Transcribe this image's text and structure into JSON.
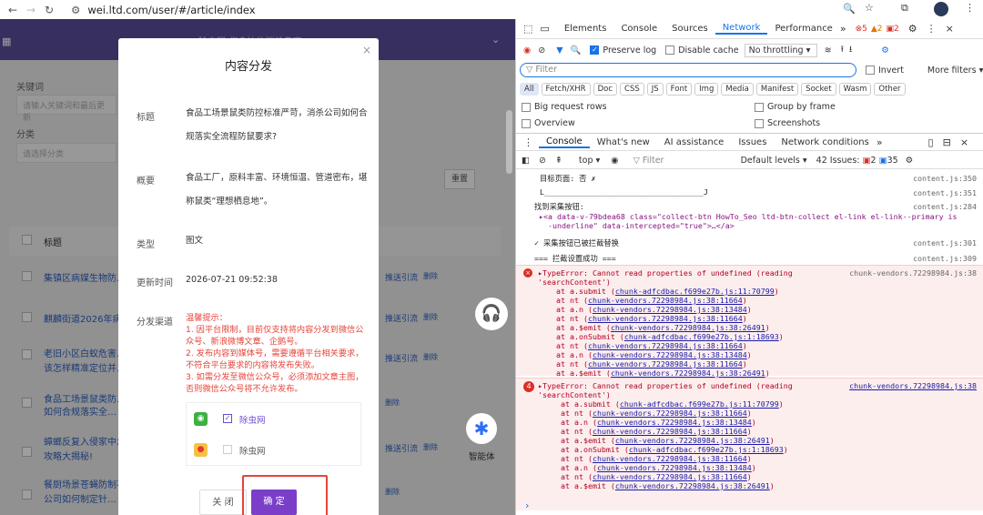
{
  "browser": {
    "url": "wei.ltd.com/user/#/article/index"
  },
  "bgpage": {
    "header": "除虫网-您身边的消杀专家",
    "keyword_label": "关键词",
    "keyword_placeholder": "请输入关键词和最后更新",
    "category_label": "分类",
    "category_placeholder": "请选择分类",
    "reset": "重置",
    "col_title": "标题",
    "rows": [
      {
        "title": "集镇区病媒生物防…",
        "a1": "推送引流",
        "a2": "删除"
      },
      {
        "title": "麒麟街道2026年病…",
        "a1": "推送引流",
        "a2": "删除"
      },
      {
        "title": "老旧小区白蚁危害…",
        "title2": "该怎样精准定位并…",
        "a1": "推送引流",
        "a2": "删除"
      },
      {
        "title": "食品工场景鼠类防…",
        "title2": "如何合规落实全…",
        "a1": "",
        "a2": "删除"
      },
      {
        "title": "蟑螂反复入侵家中怎…",
        "title2": "攻略大揭秘!",
        "a1": "推送引流",
        "a2": "删除"
      },
      {
        "title": "餐厨场景苍蝇防制不…",
        "title2": "公司如何制定针…",
        "a1": "",
        "a2": "删除"
      }
    ],
    "agent": "智能体"
  },
  "modal": {
    "title": "内容分发",
    "l_title": "标题",
    "v_title": "食品工场景鼠类防控标准严苛，消杀公司如何合规落实全流程防鼠要求?",
    "l_summary": "概要",
    "v_summary": "食品工厂，原料丰富、环境恒温、管道密布，堪称鼠类“理想栖息地”。",
    "l_type": "类型",
    "v_type": "图文",
    "l_time": "更新时间",
    "v_time": "2026-07-21 09:52:38",
    "l_channel": "分发渠道",
    "warn_title": "温馨提示：",
    "warn1": "1. 因平台限制，目前仅支持将内容分发到微信公众号、新浪微博文章、企鹅号。",
    "warn2": "2. 发布内容到媒体号，需要遵循平台相关要求，不符合平台要求的内容将发布失败。",
    "warn3": "3. 如需分发至微信公众号，必须添加文章主图，否则微信公众号将不允许发布。",
    "ch1": "除虫网",
    "ch2": "除虫网",
    "cancel": "关 闭",
    "ok": "确 定"
  },
  "devtools": {
    "tabs": [
      "Elements",
      "Console",
      "Sources",
      "Network",
      "Performance"
    ],
    "badge_err": "5",
    "badge_warn": "2",
    "badge_info": "2",
    "preserve": "Preserve log",
    "disable_cache": "Disable cache",
    "throttle": "No throttling",
    "filter": "Filter",
    "invert": "Invert",
    "more_filters": "More filters",
    "types": [
      "All",
      "Fetch/XHR",
      "Doc",
      "CSS",
      "JS",
      "Font",
      "Img",
      "Media",
      "Manifest",
      "Socket",
      "Wasm",
      "Other"
    ],
    "big": "Big request rows",
    "group": "Group by frame",
    "overview": "Overview",
    "screens": "Screenshots",
    "drawer_tabs": [
      "Console",
      "What's new",
      "AI assistance",
      "Issues",
      "Network conditions"
    ],
    "ctx": "top",
    "cfilter": "Filter",
    "levels": "Default levels",
    "issues": "42 Issues:",
    "iss_err": "2",
    "iss_info": "35",
    "logs": [
      {
        "t": "目标页面: 否 ✗",
        "s": "content.js:350"
      },
      {
        "t": "L___________________________________J",
        "s": "content.js:351"
      },
      {
        "t": "找到采集按钮:",
        "s": "content.js:284"
      },
      {
        "t": " ▸<a data-v-79bdea68 class=\"collect-btn HowTo_Seo ltd-btn-collect el-link el-link--primary is",
        "s": ""
      },
      {
        "t": "   -underline\" data-intercepted=\"true\">…</a>",
        "s": ""
      },
      {
        "t": "✓ 采集按钮已被拦截替换",
        "s": "content.js:301"
      },
      {
        "t": "=== 拦截设置成功 ===",
        "s": "content.js:309"
      }
    ],
    "err1_head": "▸TypeError: Cannot read properties of undefined (reading",
    "err1_src": "chunk-vendors.72298984.js:38",
    "err1_lines": [
      "'searchContent')",
      "    at a.submit (chunk-adfcdbac.f699e27b.js:11:70799)",
      "    at nt (chunk-vendors.72298984.js:38:11664)",
      "    at a.n (chunk-vendors.72298984.js:38:13484)",
      "    at nt (chunk-vendors.72298984.js:38:11664)",
      "    at a.$emit (chunk-vendors.72298984.js:38:26491)",
      "    at a.onSubmit (chunk-adfcdbac.f699e27b.js:1:18693)",
      "    at nt (chunk-vendors.72298984.js:38:11664)",
      "    at a.n (chunk-vendors.72298984.js:38:13484)",
      "    at nt (chunk-vendors.72298984.js:38:11664)",
      "    at a.$emit (chunk-vendors.72298984.js:38:26491)"
    ],
    "err2_count": "4",
    "err2_head": "▸TypeError: Cannot read properties of undefined (reading",
    "err2_src": "chunk-vendors.72298984.js:38",
    "err2_lines": [
      "'searchContent')",
      "     at a.submit (chunk-adfcdbac.f699e27b.js:11:70799)",
      "     at nt (chunk-vendors.72298984.js:38:11664)",
      "     at a.n (chunk-vendors.72298984.js:38:13484)",
      "     at nt (chunk-vendors.72298984.js:38:11664)",
      "     at a.$emit (chunk-vendors.72298984.js:38:26491)",
      "     at a.onSubmit (chunk-adfcdbac.f699e27b.js:1:18693)",
      "     at nt (chunk-vendors.72298984.js:38:11664)",
      "     at a.n (chunk-vendors.72298984.js:38:13484)",
      "     at nt (chunk-vendors.72298984.js:38:11664)",
      "     at a.$emit (chunk-vendors.72298984.js:38:26491)"
    ]
  }
}
